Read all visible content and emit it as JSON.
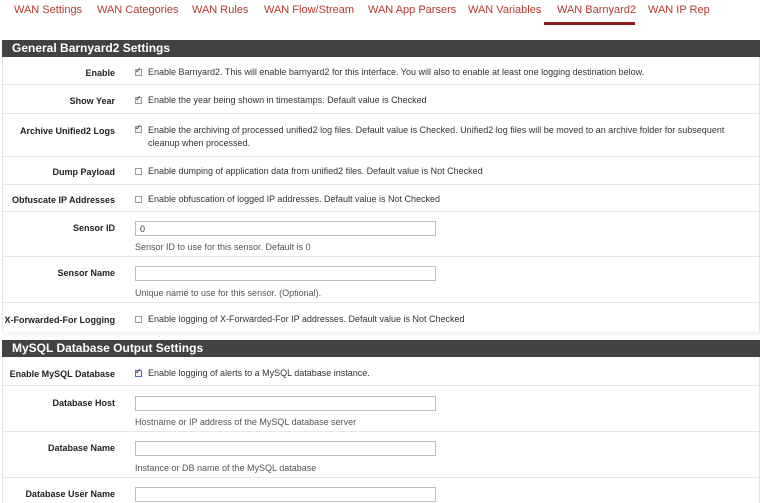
{
  "tabs": [
    {
      "label": "WAN Settings"
    },
    {
      "label": "WAN Categories"
    },
    {
      "label": "WAN Rules"
    },
    {
      "label": "WAN Flow/Stream"
    },
    {
      "label": "WAN App Parsers"
    },
    {
      "label": "WAN Variables"
    },
    {
      "label": "WAN Barnyard2",
      "active": true
    },
    {
      "label": "WAN IP Rep"
    }
  ],
  "general": {
    "title": "General Barnyard2 Settings",
    "enable": {
      "label": "Enable",
      "checked": true,
      "text": "Enable Barnyard2. This will enable barnyard2 for this interface. You will also to enable at least one logging destination below."
    },
    "show_year": {
      "label": "Show Year",
      "checked": true,
      "text": "Enable the year being shown in timestamps. Default value is Checked"
    },
    "archive": {
      "label": "Archive Unified2 Logs",
      "checked": true,
      "text": "Enable the archiving of processed unified2 log files. Default value is Checked. Unified2 log files will be moved to an archive folder for subsequent cleanup when processed."
    },
    "dump_payload": {
      "label": "Dump Payload",
      "checked": false,
      "text": "Enable dumping of application data from unified2 files. Default value is Not Checked"
    },
    "obfuscate": {
      "label": "Obfuscate IP Addresses",
      "checked": false,
      "text": "Enable obfuscation of logged IP addresses. Default value is Not Checked"
    },
    "sensor_id": {
      "label": "Sensor ID",
      "value": "0",
      "help": "Sensor ID to use for this sensor. Default is 0"
    },
    "sensor_name": {
      "label": "Sensor Name",
      "value": "",
      "help": "Unique name to use for this sensor. (Optional)."
    },
    "xff": {
      "label": "X-Forwarded-For Logging",
      "checked": false,
      "text": "Enable logging of X-Forwarded-For IP addresses. Default value is Not Checked"
    }
  },
  "mysql": {
    "title": "MySQL Database Output Settings",
    "enable": {
      "label": "Enable MySQL Database",
      "checked": true,
      "text": "Enable logging of alerts to a MySQL database instance."
    },
    "host": {
      "label": "Database Host",
      "value": "",
      "help": "Hostname or IP address of the MySQL database server"
    },
    "name": {
      "label": "Database Name",
      "value": "",
      "help": "Instance or DB name of the MySQL database"
    },
    "user": {
      "label": "Database User Name",
      "value": ""
    }
  }
}
